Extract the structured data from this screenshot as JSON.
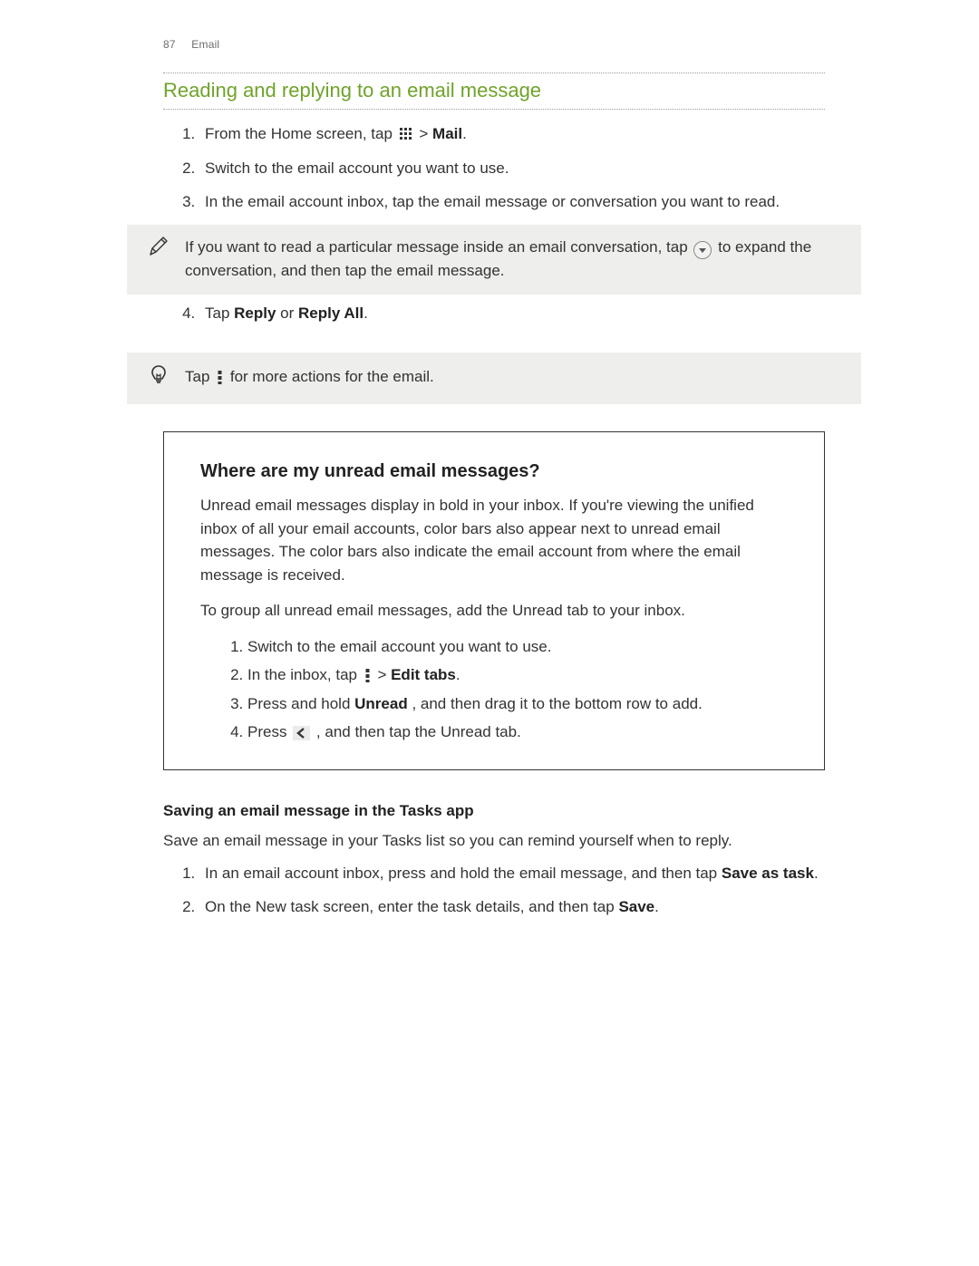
{
  "header": {
    "page_num": "87",
    "section": "Email"
  },
  "title": "Reading and replying to an email message",
  "steps_a": {
    "1a": "From the Home screen, tap ",
    "1b": " > ",
    "1c": "Mail",
    "1d": ".",
    "2": "Switch to the email account you want to use.",
    "3": "In the email account inbox, tap the email message or conversation you want to read."
  },
  "note": {
    "a": "If you want to read a particular message inside an email conversation, tap ",
    "b": " to expand the conversation, and then tap the email message."
  },
  "steps_b": {
    "4a": "Tap ",
    "4b": "Reply",
    "4c": " or ",
    "4d": "Reply All",
    "4e": "."
  },
  "tip": {
    "a": "Tap ",
    "b": " for more actions for the email."
  },
  "infobox": {
    "heading": "Where are my unread email messages?",
    "p1": "Unread email messages display in bold in your inbox. If you're viewing the unified inbox of all your email accounts, color bars also appear next to unread email messages. The color bars also indicate the email account from where the email message is received.",
    "p2": "To group all unread email messages, add the Unread tab to your inbox.",
    "steps": {
      "1": "Switch to the email account you want to use.",
      "2a": "In the inbox, tap ",
      "2b": " > ",
      "2c": "Edit tabs",
      "2d": ".",
      "3a": "Press and hold ",
      "3b": "Unread",
      "3c": ", and then drag it to the bottom row to add.",
      "4a": "Press ",
      "4b": " , and then tap the Unread tab."
    }
  },
  "subhead": "Saving an email message in the Tasks app",
  "subtext": "Save an email message in your Tasks list so you can remind yourself when to reply.",
  "steps_c": {
    "1a": "In an email account inbox, press and hold the email message, and then tap ",
    "1b": "Save as task",
    "1c": ".",
    "2a": "On the New task screen, enter the task details, and then tap ",
    "2b": "Save",
    "2c": "."
  }
}
